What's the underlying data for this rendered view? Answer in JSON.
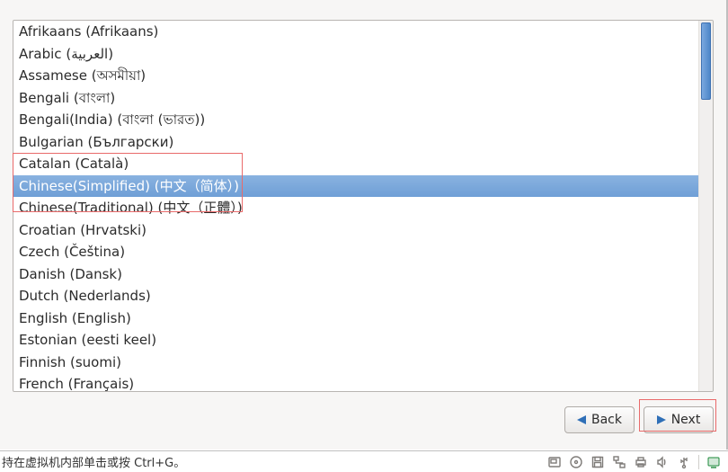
{
  "languages": {
    "items": [
      "Afrikaans (Afrikaans)",
      "Arabic (العربية)",
      "Assamese (অসমীয়া)",
      "Bengali (বাংলা)",
      "Bengali(India) (বাংলা (ভারত))",
      "Bulgarian (Български)",
      "Catalan (Català)",
      "Chinese(Simplified) (中文（简体）)",
      "Chinese(Traditional) (中文（正體）)",
      "Croatian (Hrvatski)",
      "Czech (Čeština)",
      "Danish (Dansk)",
      "Dutch (Nederlands)",
      "English (English)",
      "Estonian (eesti keel)",
      "Finnish (suomi)",
      "French (Français)"
    ],
    "selected_index": 7
  },
  "buttons": {
    "back": "Back",
    "next": "Next"
  },
  "statusbar": {
    "hint": "持在虚拟机内部单击或按 Ctrl+G。"
  }
}
